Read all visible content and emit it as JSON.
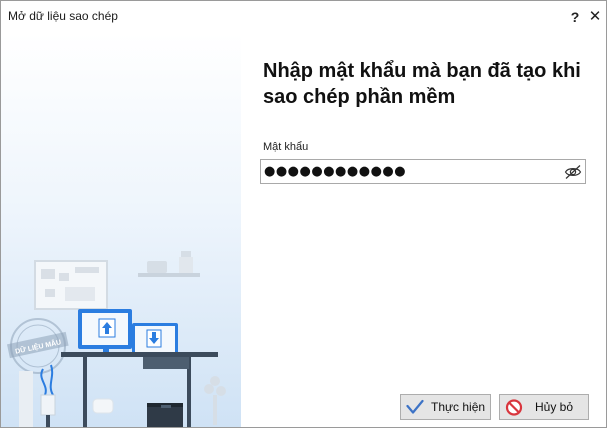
{
  "window": {
    "title": "Mở dữ liệu sao chép",
    "help_label": "?",
    "close_label": "✕"
  },
  "illustration": {
    "stamp_text": "DỮ LIỆU MẪU"
  },
  "main": {
    "heading": "Nhập mật khẩu mà bạn đã tạo khi sao chép phần mềm",
    "password_label": "Mật khẩu",
    "password_display": "●●●●●●●●●●●●"
  },
  "buttons": {
    "ok_label": "Thực hiện",
    "cancel_label": "Hủy bỏ"
  },
  "colors": {
    "accent_blue": "#2b7de0",
    "cancel_red": "#d9363e",
    "ok_check": "#3d73c6",
    "illustration_bg": "#dbe9f7"
  }
}
